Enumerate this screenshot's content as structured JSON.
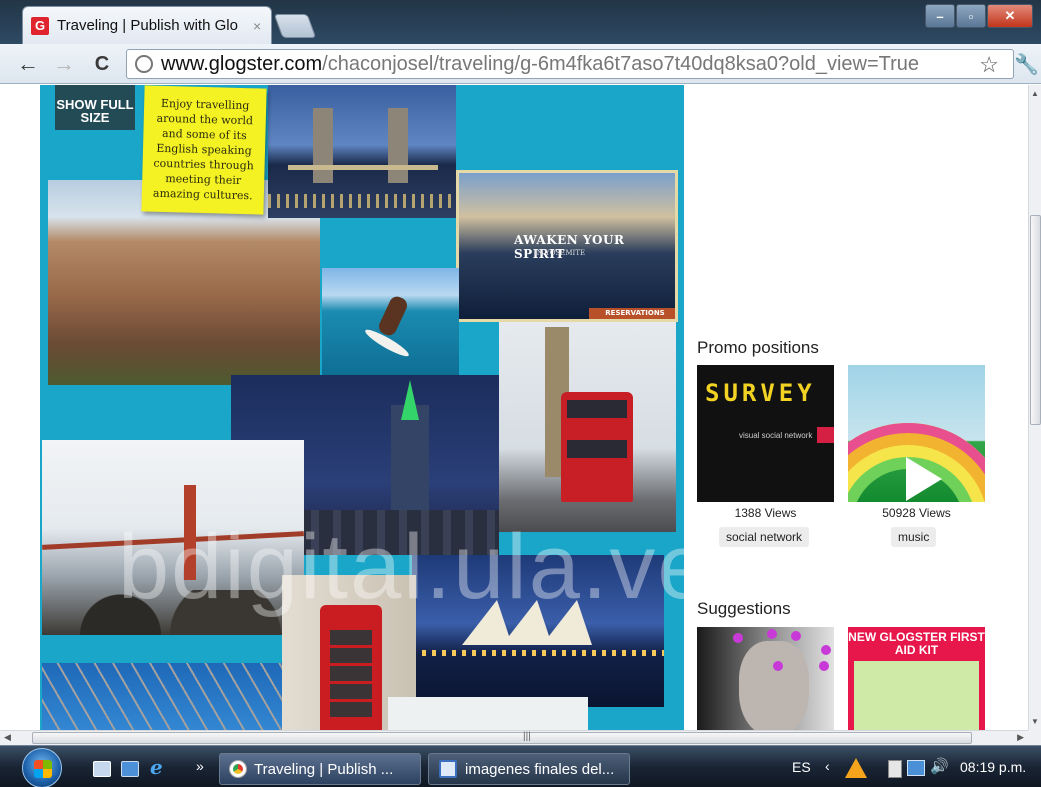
{
  "browser": {
    "tab_title": "Traveling | Publish with Glo",
    "favicon_letter": "G",
    "tab_close": "×",
    "url_host": "www.glogster.com",
    "url_path": "/chaconjosel/traveling/g-6m4fka6t7aso7t40dq8ksa0?old_view=True",
    "icons": [
      "back-icon",
      "forward-icon",
      "reload-icon",
      "globe-icon",
      "star-icon",
      "wrench-icon"
    ]
  },
  "glog": {
    "show_full_size": "SHOW FULL SIZE",
    "sticky_note": "Enjoy travelling around the world and some of its English speaking countries through meeting their amazing cultures.",
    "yosemite_title": "AWAKEN YOUR SPIRIT",
    "yosemite_sub": "IN YOSEMITE",
    "yosemite_button": "RESERVATIONS",
    "background_color": "#1aa6c9"
  },
  "watermark": "bdigital.ula.ve",
  "sidebar": {
    "promo_heading": "Promo positions",
    "promos": [
      {
        "title": "SURVEY",
        "subtitle": "visual social network",
        "views": "1388 Views",
        "tag": "social network"
      },
      {
        "title": "",
        "subtitle": "",
        "views": "50928 Views",
        "tag": "music"
      }
    ],
    "suggestions_heading": "Suggestions",
    "suggestions": [
      {
        "title": ""
      },
      {
        "title": "NEW GLOGSTER FIRST AID KIT"
      }
    ]
  },
  "taskbar": {
    "tasks": [
      {
        "label": "Traveling | Publish ..."
      },
      {
        "label": "imagenes finales del..."
      }
    ],
    "quicklaunch_more": "»",
    "language": "ES",
    "clock": "08:19 p.m."
  }
}
